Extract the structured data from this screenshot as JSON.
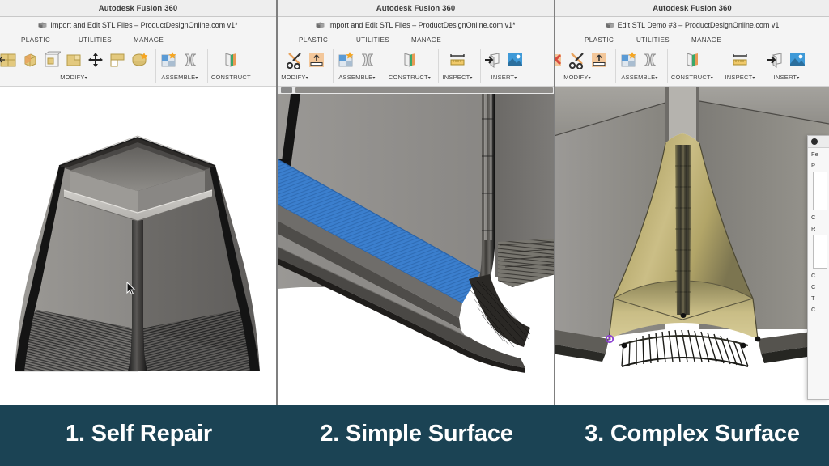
{
  "panels": [
    {
      "window_title": "Autodesk Fusion 360",
      "document_title": "Import and Edit STL Files – ProductDesignOnline.com v1*",
      "tabs": [
        "PLASTIC",
        "UTILITIES",
        "MANAGE"
      ],
      "ribbon_groups": [
        {
          "label": "MODIFY",
          "caret": "▾",
          "icons": [
            "press-pull-icon",
            "fillet-icon",
            "shell-icon",
            "combine-icon",
            "move-copy-icon",
            "align-icon",
            "mesh-edit-icon"
          ]
        },
        {
          "label": "ASSEMBLE",
          "caret": "▾",
          "icons": [
            "new-component-icon",
            "joint-icon"
          ]
        },
        {
          "label": "CONSTRUCT",
          "caret": "",
          "icons": [
            "offset-plane-icon"
          ]
        }
      ],
      "caption": "1. Self Repair",
      "cursor": "arrow-pointer-icon",
      "viewport_subject": "tapered-enclosure-stl-model"
    },
    {
      "window_title": "Autodesk Fusion 360",
      "document_title": "Import and Edit STL Files – ProductDesignOnline.com v1*",
      "tabs": [
        "PLASTIC",
        "UTILITIES",
        "MANAGE"
      ],
      "ribbon_groups": [
        {
          "label": "MODIFY",
          "caret": "▾",
          "icons": [
            "delete-icon",
            "split-face-icon",
            "offset-face-icon"
          ]
        },
        {
          "label": "ASSEMBLE",
          "caret": "▾",
          "icons": [
            "new-component-icon",
            "joint-icon"
          ]
        },
        {
          "label": "CONSTRUCT",
          "caret": "▾",
          "icons": [
            "offset-plane-icon"
          ]
        },
        {
          "label": "INSPECT",
          "caret": "▾",
          "icons": [
            "measure-icon"
          ]
        },
        {
          "label": "INSERT",
          "caret": "▾",
          "icons": [
            "insert-derive-icon",
            "decal-icon"
          ]
        }
      ],
      "caption": "2. Simple Surface",
      "viewport_subject": "zoomed-corner-with-selected-planar-face",
      "selection_color": "#3b7fce"
    },
    {
      "window_title": "Autodesk Fusion 360",
      "document_title": "Edit STL Demo #3 – ProductDesignOnline.com v1",
      "tabs": [
        "PLASTIC",
        "UTILITIES",
        "MANAGE"
      ],
      "ribbon_groups": [
        {
          "label": "MODIFY",
          "caret": "▾",
          "icons": [
            "delete-icon",
            "split-face-icon",
            "offset-face-icon"
          ]
        },
        {
          "label": "ASSEMBLE",
          "caret": "▾",
          "icons": [
            "new-component-icon",
            "joint-icon"
          ]
        },
        {
          "label": "CONSTRUCT",
          "caret": "▾",
          "icons": [
            "offset-plane-icon"
          ]
        },
        {
          "label": "INSPECT",
          "caret": "▾",
          "icons": [
            "measure-icon"
          ]
        },
        {
          "label": "INSERT",
          "caret": "▾",
          "icons": [
            "insert-derive-icon"
          ]
        }
      ],
      "caption": "3. Complex Surface",
      "viewport_subject": "corner-fillet-patch-surface",
      "surface_color": "#b8ab6e",
      "dialog": {
        "title_fragment": "Fe",
        "rows": [
          "P",
          "C",
          "R",
          "C",
          "C",
          "T",
          "C"
        ]
      }
    }
  ],
  "theme": {
    "caption_bar_bg": "#1b4354",
    "caption_text": "#ffffff",
    "window_chrome_bg": "#eeeeee",
    "ribbon_bg": "#f4f4f4",
    "panel_divider": "#7f7f7f"
  }
}
